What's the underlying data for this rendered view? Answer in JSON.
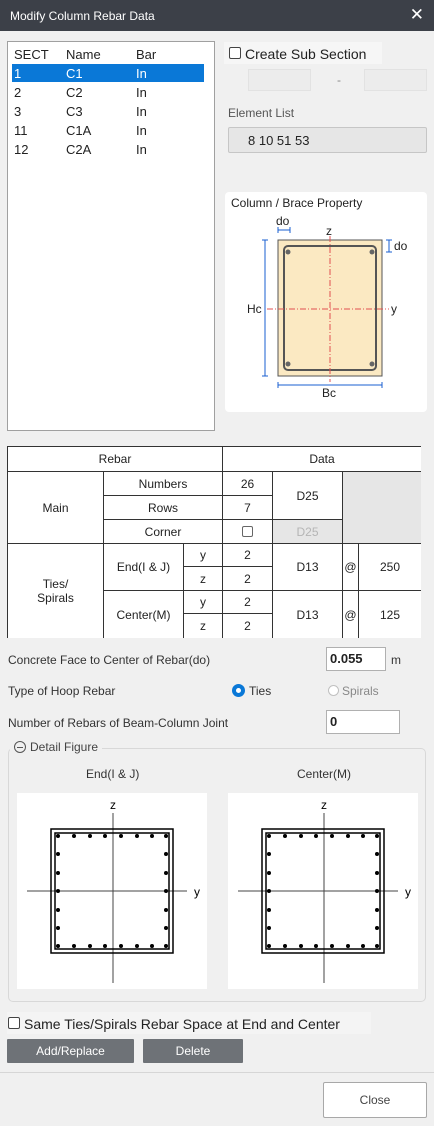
{
  "window": {
    "title": "Modify Column Rebar Data"
  },
  "section_list": {
    "headers": [
      "SECT",
      "Name",
      "Bar"
    ],
    "rows": [
      {
        "sect": "1",
        "name": "C1",
        "bar": "In",
        "selected": true
      },
      {
        "sect": "2",
        "name": "C2",
        "bar": "In",
        "selected": false
      },
      {
        "sect": "3",
        "name": "C3",
        "bar": "In",
        "selected": false
      },
      {
        "sect": "11",
        "name": "C1A",
        "bar": "In",
        "selected": false
      },
      {
        "sect": "12",
        "name": "C2A",
        "bar": "In",
        "selected": false
      }
    ]
  },
  "sub_section": {
    "label": "Create Sub Section",
    "checked": false,
    "dash": "-"
  },
  "element_list": {
    "label": "Element List",
    "value": "8 10 51 53"
  },
  "property": {
    "title": "Column / Brace Property",
    "labels": {
      "do_top": "do",
      "do_right": "do",
      "z": "z",
      "y": "y",
      "hc": "Hc",
      "bc": "Bc"
    }
  },
  "rebar_table": {
    "h_rebar": "Rebar",
    "h_data": "Data",
    "main": "Main",
    "numbers": "Numbers",
    "rows": "Rows",
    "corner": "Corner",
    "numbers_val": "26",
    "rows_val": "7",
    "main_bar": "D25",
    "corner_bar": "D25",
    "ties": "Ties/\nSpirals",
    "end": "End(I & J)",
    "center": "Center(M)",
    "y": "y",
    "z": "z",
    "end_y": "2",
    "end_z": "2",
    "end_bar": "D13",
    "at": "@",
    "end_space": "250",
    "center_y": "2",
    "center_z": "2",
    "center_bar": "D13",
    "center_space": "125"
  },
  "form": {
    "do_label": "Concrete Face to Center of Rebar(do)",
    "do_value": "0.055",
    "do_unit": "m",
    "hoop_label": "Type of Hoop Rebar",
    "ties": "Ties",
    "spirals": "Spirals",
    "joint_label": "Number of Rebars of Beam-Column Joint",
    "joint_value": "0"
  },
  "detail": {
    "title": "Detail Figure",
    "end_label": "End(I & J)",
    "center_label": "Center(M)",
    "axis_z": "z",
    "axis_y": "y"
  },
  "same_space": {
    "label": "Same Ties/Spirals Rebar Space at End and Center",
    "checked": false
  },
  "buttons": {
    "add_replace": "Add/Replace",
    "delete": "Delete",
    "close": "Close"
  },
  "colors": {
    "selection": "#0a78d7",
    "dim_blue": "#1a5fd0",
    "center_line": "#e05050",
    "concrete": "#fbe9c2"
  }
}
